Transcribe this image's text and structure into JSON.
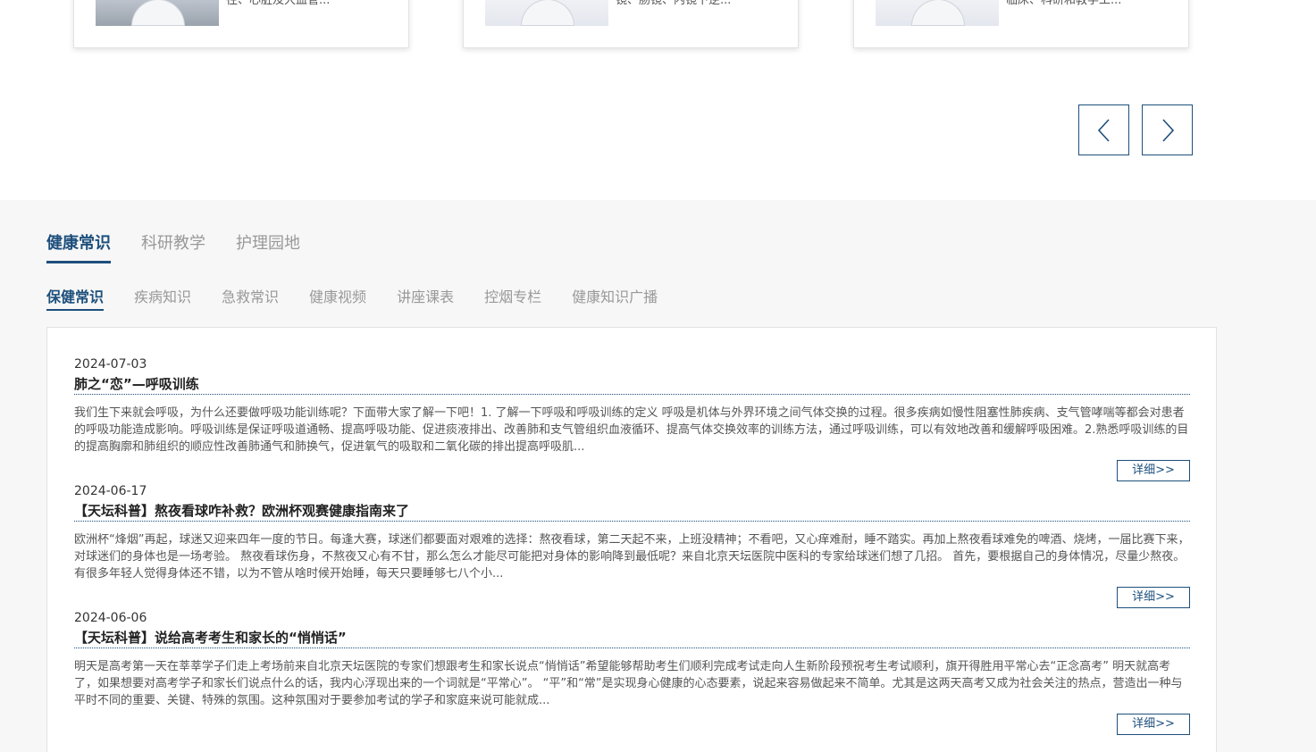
{
  "doctors": [
    {
      "excerpt": "往、心脏及大血管..."
    },
    {
      "excerpt": "镜、肠镜、内镜下逆..."
    },
    {
      "excerpt": "临床、科研和教学工..."
    }
  ],
  "pager": {
    "prev_icon": "chevron-left-icon",
    "next_icon": "chevron-right-icon"
  },
  "main_tabs": [
    {
      "label": "健康常识"
    },
    {
      "label": "科研教学"
    },
    {
      "label": "护理园地"
    }
  ],
  "sub_tabs": [
    {
      "label": "保健常识"
    },
    {
      "label": "疾病知识"
    },
    {
      "label": "急救常识"
    },
    {
      "label": "健康视频"
    },
    {
      "label": "讲座课表"
    },
    {
      "label": "控烟专栏"
    },
    {
      "label": "健康知识广播"
    }
  ],
  "news": [
    {
      "date": "2024-07-03",
      "title": "肺之“恋”—呼吸训练",
      "body": "我们生下来就会呼吸，为什么还要做呼吸功能训练呢？下面带大家了解一下吧！1. 了解一下呼吸和呼吸训练的定义 呼吸是机体与外界环境之间气体交换的过程。很多疾病如慢性阻塞性肺疾病、支气管哮喘等都会对患者的呼吸功能造成影响。呼吸训练是保证呼吸道通畅、提高呼吸功能、促进痰液排出、改善肺和支气管组织血液循环、提高气体交换效率的训练方法，通过呼吸训练，可以有效地改善和缓解呼吸困难。2.熟悉呼吸训练的目的提高胸廓和肺组织的顺应性改善肺通气和肺换气，促进氧气的吸取和二氧化碳的排出提高呼吸肌...",
      "detail_label": "详细>>"
    },
    {
      "date": "2024-06-17",
      "title": "【天坛科普】熬夜看球咋补救？欧洲杯观赛健康指南来了",
      "body": "欧洲杯“烽烟”再起，球迷又迎来四年一度的节日。每逢大赛，球迷们都要面对艰难的选择：熬夜看球，第二天起不来，上班没精神；不看吧，又心痒难耐，睡不踏实。再加上熬夜看球难免的啤酒、烧烤，一届比赛下来，对球迷们的身体也是一场考验。 熬夜看球伤身，不熬夜又心有不甘，那么怎么才能尽可能把对身体的影响降到最低呢？来自北京天坛医院中医科的专家给球迷们想了几招。 首先，要根据自己的身体情况，尽量少熬夜。 有很多年轻人觉得身体还不错，以为不管从啥时候开始睡，每天只要睡够七八个小...",
      "detail_label": "详细>>"
    },
    {
      "date": "2024-06-06",
      "title": "【天坛科普】说给高考考生和家长的“悄悄话”",
      "body": "明天是高考第一天在莘莘学子们走上考场前来自北京天坛医院的专家们想跟考生和家长说点“悄悄话”希望能够帮助考生们顺利完成考试走向人生新阶段预祝考生考试顺利，旗开得胜用平常心去“正念高考” 明天就高考了，如果想要对高考学子和家长们说点什么的话，我内心浮现出来的一个词就是“平常心”。 “平”和“常”是实现身心健康的心态要素，说起来容易做起来不简单。尤其是这两天高考又成为社会关注的热点，营造出一种与平时不同的重要、关键、特殊的氛围。这种氛围对于要参加考试的学子和家庭来说可能就成...",
      "detail_label": "详细>>"
    }
  ],
  "colors": {
    "accent": "#1d4f7c",
    "section_bg": "#f7f7f7",
    "muted": "#999999"
  }
}
